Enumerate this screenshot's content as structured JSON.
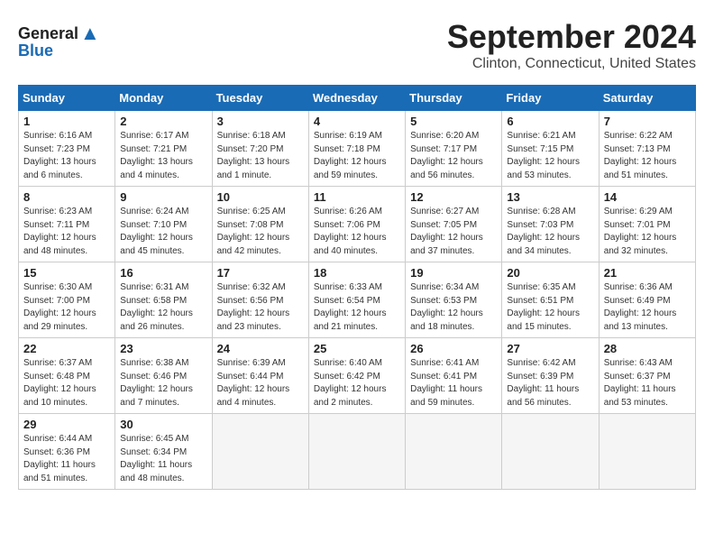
{
  "logo": {
    "line1": "General",
    "line2": "Blue",
    "bird_unicode": "🐦"
  },
  "header": {
    "title": "September 2024",
    "subtitle": "Clinton, Connecticut, United States"
  },
  "days_of_week": [
    "Sunday",
    "Monday",
    "Tuesday",
    "Wednesday",
    "Thursday",
    "Friday",
    "Saturday"
  ],
  "weeks": [
    [
      {
        "num": "1",
        "rise": "6:16 AM",
        "set": "7:23 PM",
        "daylight": "13 hours and 6 minutes."
      },
      {
        "num": "2",
        "rise": "6:17 AM",
        "set": "7:21 PM",
        "daylight": "13 hours and 4 minutes."
      },
      {
        "num": "3",
        "rise": "6:18 AM",
        "set": "7:20 PM",
        "daylight": "13 hours and 1 minute."
      },
      {
        "num": "4",
        "rise": "6:19 AM",
        "set": "7:18 PM",
        "daylight": "12 hours and 59 minutes."
      },
      {
        "num": "5",
        "rise": "6:20 AM",
        "set": "7:17 PM",
        "daylight": "12 hours and 56 minutes."
      },
      {
        "num": "6",
        "rise": "6:21 AM",
        "set": "7:15 PM",
        "daylight": "12 hours and 53 minutes."
      },
      {
        "num": "7",
        "rise": "6:22 AM",
        "set": "7:13 PM",
        "daylight": "12 hours and 51 minutes."
      }
    ],
    [
      {
        "num": "8",
        "rise": "6:23 AM",
        "set": "7:11 PM",
        "daylight": "12 hours and 48 minutes."
      },
      {
        "num": "9",
        "rise": "6:24 AM",
        "set": "7:10 PM",
        "daylight": "12 hours and 45 minutes."
      },
      {
        "num": "10",
        "rise": "6:25 AM",
        "set": "7:08 PM",
        "daylight": "12 hours and 42 minutes."
      },
      {
        "num": "11",
        "rise": "6:26 AM",
        "set": "7:06 PM",
        "daylight": "12 hours and 40 minutes."
      },
      {
        "num": "12",
        "rise": "6:27 AM",
        "set": "7:05 PM",
        "daylight": "12 hours and 37 minutes."
      },
      {
        "num": "13",
        "rise": "6:28 AM",
        "set": "7:03 PM",
        "daylight": "12 hours and 34 minutes."
      },
      {
        "num": "14",
        "rise": "6:29 AM",
        "set": "7:01 PM",
        "daylight": "12 hours and 32 minutes."
      }
    ],
    [
      {
        "num": "15",
        "rise": "6:30 AM",
        "set": "7:00 PM",
        "daylight": "12 hours and 29 minutes."
      },
      {
        "num": "16",
        "rise": "6:31 AM",
        "set": "6:58 PM",
        "daylight": "12 hours and 26 minutes."
      },
      {
        "num": "17",
        "rise": "6:32 AM",
        "set": "6:56 PM",
        "daylight": "12 hours and 23 minutes."
      },
      {
        "num": "18",
        "rise": "6:33 AM",
        "set": "6:54 PM",
        "daylight": "12 hours and 21 minutes."
      },
      {
        "num": "19",
        "rise": "6:34 AM",
        "set": "6:53 PM",
        "daylight": "12 hours and 18 minutes."
      },
      {
        "num": "20",
        "rise": "6:35 AM",
        "set": "6:51 PM",
        "daylight": "12 hours and 15 minutes."
      },
      {
        "num": "21",
        "rise": "6:36 AM",
        "set": "6:49 PM",
        "daylight": "12 hours and 13 minutes."
      }
    ],
    [
      {
        "num": "22",
        "rise": "6:37 AM",
        "set": "6:48 PM",
        "daylight": "12 hours and 10 minutes."
      },
      {
        "num": "23",
        "rise": "6:38 AM",
        "set": "6:46 PM",
        "daylight": "12 hours and 7 minutes."
      },
      {
        "num": "24",
        "rise": "6:39 AM",
        "set": "6:44 PM",
        "daylight": "12 hours and 4 minutes."
      },
      {
        "num": "25",
        "rise": "6:40 AM",
        "set": "6:42 PM",
        "daylight": "12 hours and 2 minutes."
      },
      {
        "num": "26",
        "rise": "6:41 AM",
        "set": "6:41 PM",
        "daylight": "11 hours and 59 minutes."
      },
      {
        "num": "27",
        "rise": "6:42 AM",
        "set": "6:39 PM",
        "daylight": "11 hours and 56 minutes."
      },
      {
        "num": "28",
        "rise": "6:43 AM",
        "set": "6:37 PM",
        "daylight": "11 hours and 53 minutes."
      }
    ],
    [
      {
        "num": "29",
        "rise": "6:44 AM",
        "set": "6:36 PM",
        "daylight": "11 hours and 51 minutes."
      },
      {
        "num": "30",
        "rise": "6:45 AM",
        "set": "6:34 PM",
        "daylight": "11 hours and 48 minutes."
      },
      null,
      null,
      null,
      null,
      null
    ]
  ]
}
